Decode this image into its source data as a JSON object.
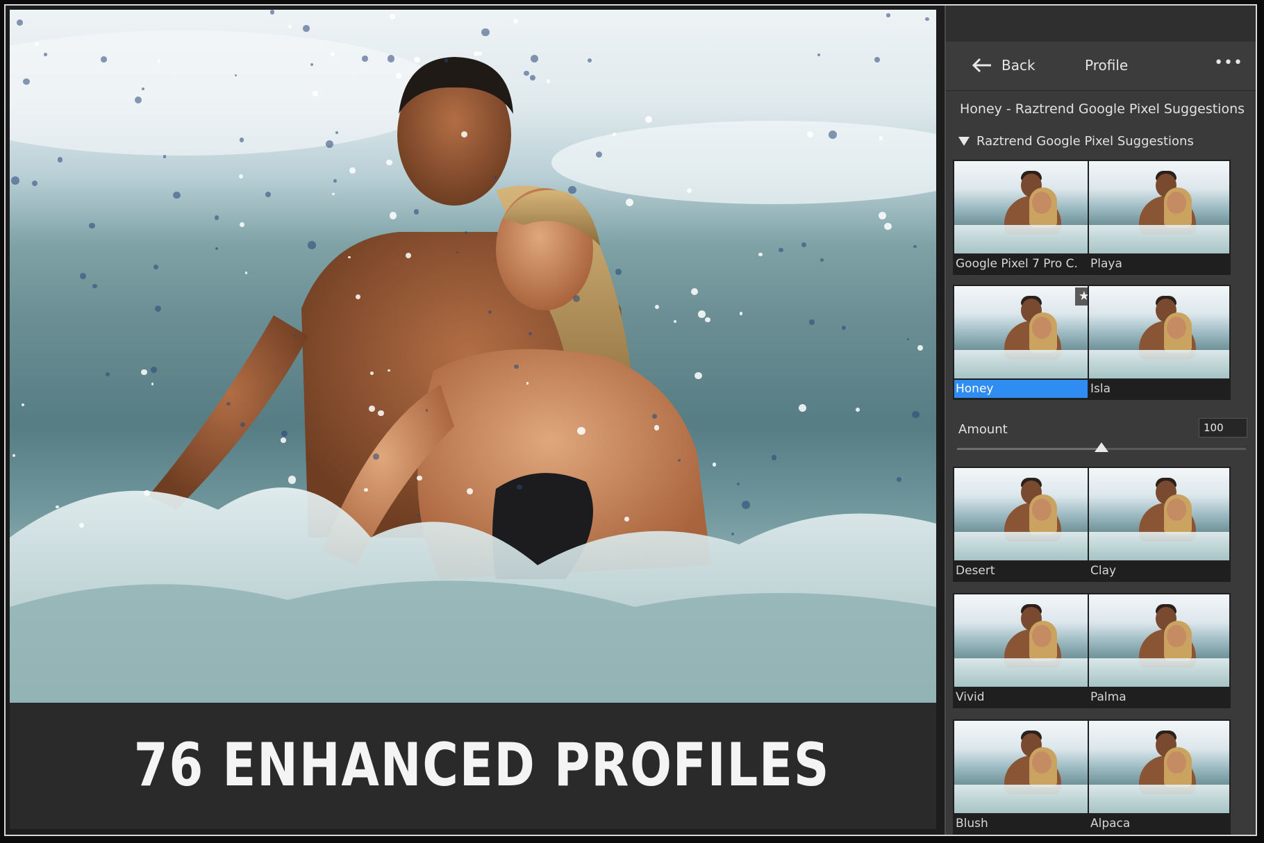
{
  "caption": "76 ENHANCED PROFILES",
  "panel": {
    "back_label": "Back",
    "title": "Profile",
    "more_label": "•••",
    "selected_profile_name": "Honey - Raztrend Google Pixel Suggestions",
    "group_label": "Raztrend Google Pixel Suggestions",
    "amount_label": "Amount",
    "amount_value": "100",
    "amount_fraction": 0.5,
    "selected_color": "#2f8cf0",
    "profiles_top": [
      {
        "label": "Google Pixel 7 Pro C."
      },
      {
        "label": "Playa"
      },
      {
        "label": "Honey",
        "selected": true,
        "favorite": true
      },
      {
        "label": "Isla"
      }
    ],
    "profiles_bottom": [
      {
        "label": "Desert"
      },
      {
        "label": "Clay"
      },
      {
        "label": "Vivid"
      },
      {
        "label": "Palma"
      },
      {
        "label": "Blush"
      },
      {
        "label": "Alpaca"
      }
    ],
    "icons": {
      "back": "arrow-left-icon",
      "group": "disclosure-triangle-icon",
      "favorite": "star-icon"
    }
  }
}
